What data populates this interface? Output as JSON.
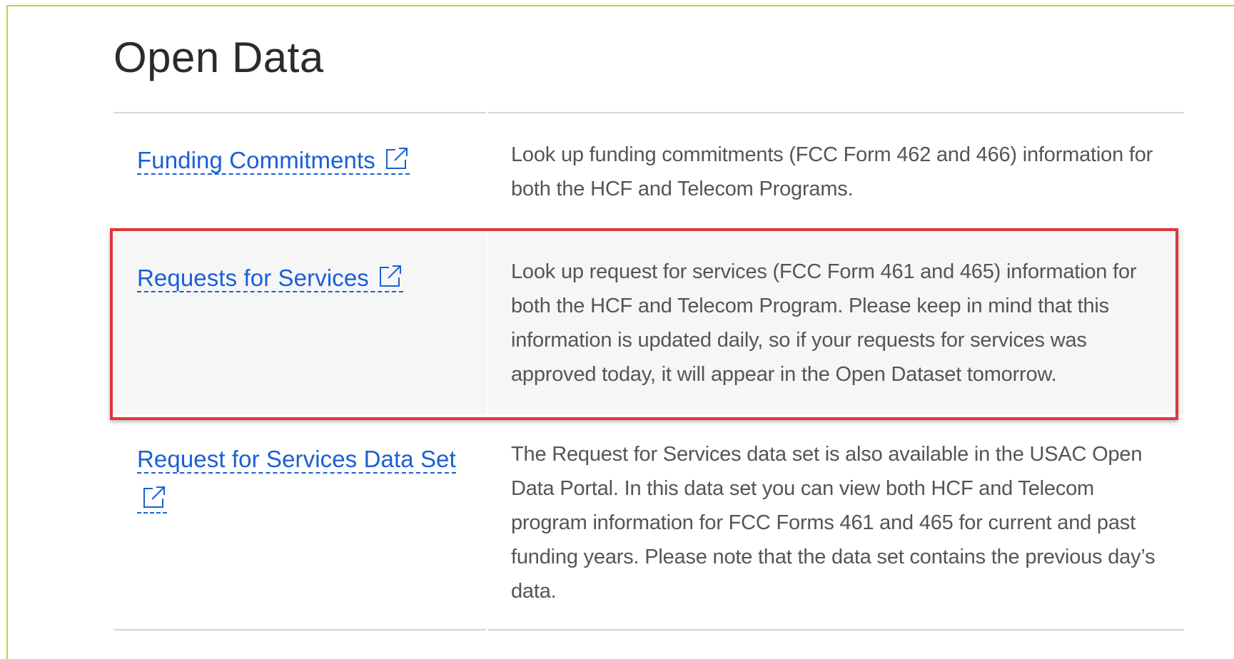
{
  "page": {
    "title": "Open Data"
  },
  "rows": [
    {
      "link_label": "Funding Commitments",
      "description": "Look up funding commitments (FCC Form 462 and 466) information for both the HCF and Telecom Programs."
    },
    {
      "link_label": "Requests for Services",
      "description": "Look up request for services (FCC Form 461 and 465)  information for both the HCF and Telecom Program. Please keep in mind that this information is updated daily, so if your requests for services was approved today, it will appear in the Open Dataset tomorrow."
    },
    {
      "link_label": "Request for Services Data Set",
      "description": "The Request for Services data set is also available in the USAC Open Data Portal. In this data set you can view both HCF and Telecom program information for FCC Forms 461 and 465 for current and past funding years. Please note that the data set contains the previous day’s data."
    }
  ],
  "icons": {
    "external_link": "external-link-icon"
  },
  "colors": {
    "link": "#1a5fd6",
    "highlight_border": "#e0353b",
    "highlight_background": "#f6f6f6",
    "frame_border": "#c9cf3c"
  }
}
